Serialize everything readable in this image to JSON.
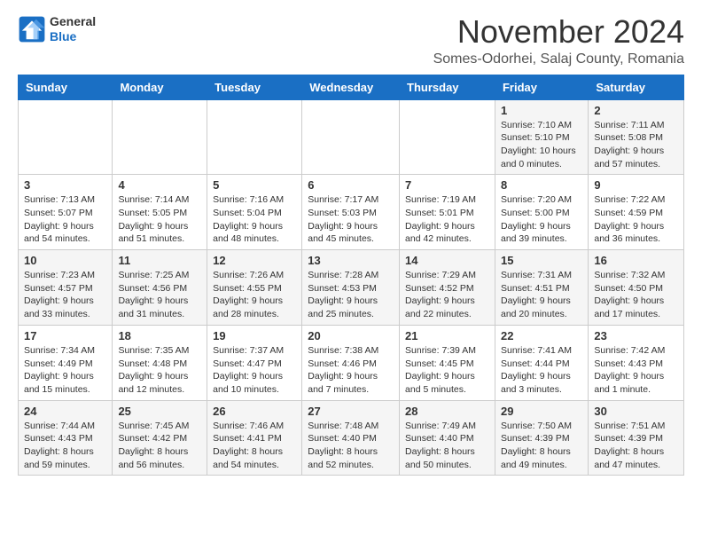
{
  "header": {
    "logo_general": "General",
    "logo_blue": "Blue",
    "month_title": "November 2024",
    "subtitle": "Somes-Odorhei, Salaj County, Romania"
  },
  "weekdays": [
    "Sunday",
    "Monday",
    "Tuesday",
    "Wednesday",
    "Thursday",
    "Friday",
    "Saturday"
  ],
  "weeks": [
    [
      {
        "day": "",
        "info": ""
      },
      {
        "day": "",
        "info": ""
      },
      {
        "day": "",
        "info": ""
      },
      {
        "day": "",
        "info": ""
      },
      {
        "day": "",
        "info": ""
      },
      {
        "day": "1",
        "info": "Sunrise: 7:10 AM\nSunset: 5:10 PM\nDaylight: 10 hours\nand 0 minutes."
      },
      {
        "day": "2",
        "info": "Sunrise: 7:11 AM\nSunset: 5:08 PM\nDaylight: 9 hours\nand 57 minutes."
      }
    ],
    [
      {
        "day": "3",
        "info": "Sunrise: 7:13 AM\nSunset: 5:07 PM\nDaylight: 9 hours\nand 54 minutes."
      },
      {
        "day": "4",
        "info": "Sunrise: 7:14 AM\nSunset: 5:05 PM\nDaylight: 9 hours\nand 51 minutes."
      },
      {
        "day": "5",
        "info": "Sunrise: 7:16 AM\nSunset: 5:04 PM\nDaylight: 9 hours\nand 48 minutes."
      },
      {
        "day": "6",
        "info": "Sunrise: 7:17 AM\nSunset: 5:03 PM\nDaylight: 9 hours\nand 45 minutes."
      },
      {
        "day": "7",
        "info": "Sunrise: 7:19 AM\nSunset: 5:01 PM\nDaylight: 9 hours\nand 42 minutes."
      },
      {
        "day": "8",
        "info": "Sunrise: 7:20 AM\nSunset: 5:00 PM\nDaylight: 9 hours\nand 39 minutes."
      },
      {
        "day": "9",
        "info": "Sunrise: 7:22 AM\nSunset: 4:59 PM\nDaylight: 9 hours\nand 36 minutes."
      }
    ],
    [
      {
        "day": "10",
        "info": "Sunrise: 7:23 AM\nSunset: 4:57 PM\nDaylight: 9 hours\nand 33 minutes."
      },
      {
        "day": "11",
        "info": "Sunrise: 7:25 AM\nSunset: 4:56 PM\nDaylight: 9 hours\nand 31 minutes."
      },
      {
        "day": "12",
        "info": "Sunrise: 7:26 AM\nSunset: 4:55 PM\nDaylight: 9 hours\nand 28 minutes."
      },
      {
        "day": "13",
        "info": "Sunrise: 7:28 AM\nSunset: 4:53 PM\nDaylight: 9 hours\nand 25 minutes."
      },
      {
        "day": "14",
        "info": "Sunrise: 7:29 AM\nSunset: 4:52 PM\nDaylight: 9 hours\nand 22 minutes."
      },
      {
        "day": "15",
        "info": "Sunrise: 7:31 AM\nSunset: 4:51 PM\nDaylight: 9 hours\nand 20 minutes."
      },
      {
        "day": "16",
        "info": "Sunrise: 7:32 AM\nSunset: 4:50 PM\nDaylight: 9 hours\nand 17 minutes."
      }
    ],
    [
      {
        "day": "17",
        "info": "Sunrise: 7:34 AM\nSunset: 4:49 PM\nDaylight: 9 hours\nand 15 minutes."
      },
      {
        "day": "18",
        "info": "Sunrise: 7:35 AM\nSunset: 4:48 PM\nDaylight: 9 hours\nand 12 minutes."
      },
      {
        "day": "19",
        "info": "Sunrise: 7:37 AM\nSunset: 4:47 PM\nDaylight: 9 hours\nand 10 minutes."
      },
      {
        "day": "20",
        "info": "Sunrise: 7:38 AM\nSunset: 4:46 PM\nDaylight: 9 hours\nand 7 minutes."
      },
      {
        "day": "21",
        "info": "Sunrise: 7:39 AM\nSunset: 4:45 PM\nDaylight: 9 hours\nand 5 minutes."
      },
      {
        "day": "22",
        "info": "Sunrise: 7:41 AM\nSunset: 4:44 PM\nDaylight: 9 hours\nand 3 minutes."
      },
      {
        "day": "23",
        "info": "Sunrise: 7:42 AM\nSunset: 4:43 PM\nDaylight: 9 hours\nand 1 minute."
      }
    ],
    [
      {
        "day": "24",
        "info": "Sunrise: 7:44 AM\nSunset: 4:43 PM\nDaylight: 8 hours\nand 59 minutes."
      },
      {
        "day": "25",
        "info": "Sunrise: 7:45 AM\nSunset: 4:42 PM\nDaylight: 8 hours\nand 56 minutes."
      },
      {
        "day": "26",
        "info": "Sunrise: 7:46 AM\nSunset: 4:41 PM\nDaylight: 8 hours\nand 54 minutes."
      },
      {
        "day": "27",
        "info": "Sunrise: 7:48 AM\nSunset: 4:40 PM\nDaylight: 8 hours\nand 52 minutes."
      },
      {
        "day": "28",
        "info": "Sunrise: 7:49 AM\nSunset: 4:40 PM\nDaylight: 8 hours\nand 50 minutes."
      },
      {
        "day": "29",
        "info": "Sunrise: 7:50 AM\nSunset: 4:39 PM\nDaylight: 8 hours\nand 49 minutes."
      },
      {
        "day": "30",
        "info": "Sunrise: 7:51 AM\nSunset: 4:39 PM\nDaylight: 8 hours\nand 47 minutes."
      }
    ]
  ]
}
